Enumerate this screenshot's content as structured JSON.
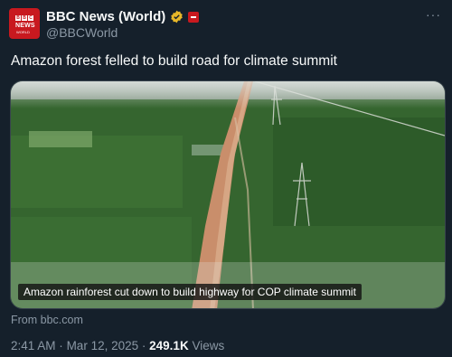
{
  "author": {
    "name": "BBC News (World)",
    "handle": "@BBCWorld",
    "avatar_lines": [
      "B",
      "B",
      "C",
      "NEWS",
      "WORLD"
    ]
  },
  "post": {
    "text": "Amazon forest felled to build road for climate summit",
    "video_caption": "Amazon rainforest cut down to build highway for COP climate summit",
    "source": "From bbc.com",
    "time": "2:41 AM",
    "date": "Mar 12, 2025",
    "separator": "·",
    "views_count": "249.1K",
    "views_label": "Views"
  },
  "more_label": "···",
  "icons": [
    "bbc-logo-icon",
    "verified-badge-icon",
    "org-affiliation-icon",
    "more-options-icon"
  ],
  "colors": {
    "background": "#15202b",
    "text": "#f7f9f9",
    "secondary": "#8b98a5",
    "bbc_red": "#c8191f",
    "verified_gold": "#e8b829"
  }
}
